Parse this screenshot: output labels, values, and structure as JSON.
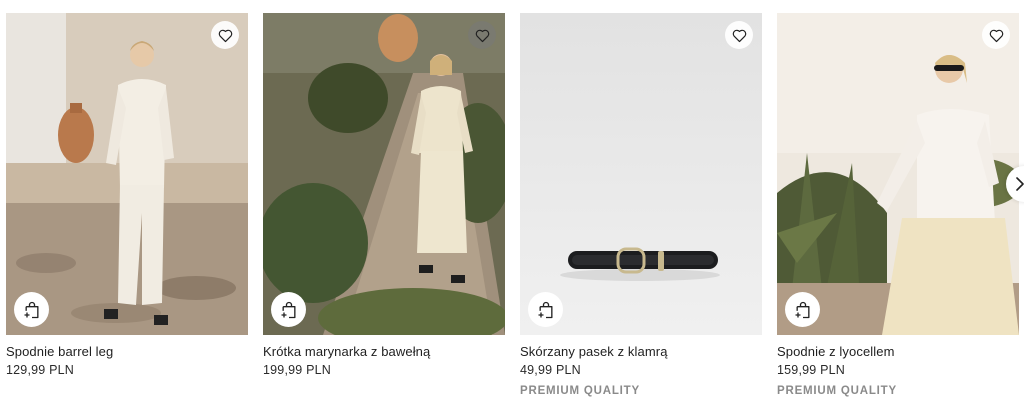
{
  "products": [
    {
      "name": "Spodnie barrel leg",
      "price": "129,99 PLN",
      "badge": "",
      "wishlist_icon": "heart-outline-icon",
      "cart_icon": "bag-add-icon"
    },
    {
      "name": "Krótka marynarka z bawełną",
      "price": "199,99 PLN",
      "badge": "",
      "wishlist_icon": "heart-outline-icon",
      "cart_icon": "bag-add-icon"
    },
    {
      "name": "Skórzany pasek z klamrą",
      "price": "49,99 PLN",
      "badge": "PREMIUM QUALITY",
      "wishlist_icon": "heart-outline-icon",
      "cart_icon": "bag-add-icon"
    },
    {
      "name": "Spodnie z lyocellem",
      "price": "159,99 PLN",
      "badge": "PREMIUM QUALITY",
      "wishlist_icon": "heart-outline-icon",
      "cart_icon": "bag-add-icon"
    }
  ],
  "carousel": {
    "next_icon": "chevron-right-icon"
  },
  "colors": {
    "text": "#1f1f1f",
    "badge": "#8a8a8a",
    "background": "#ffffff"
  }
}
